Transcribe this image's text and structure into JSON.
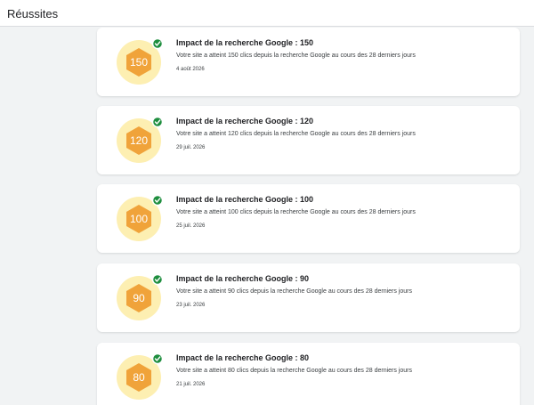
{
  "header": {
    "title": "Réussites"
  },
  "colors": {
    "badge_ring": "#fdefb2",
    "badge_hex": "#f0a33a",
    "check": "#1e8e3e"
  },
  "achievements": [
    {
      "value": "150",
      "title": "Impact de la recherche Google : 150",
      "description": "Votre site a atteint 150 clics depuis la recherche Google au cours des 28 derniers jours",
      "date": "4 août 2026"
    },
    {
      "value": "120",
      "title": "Impact de la recherche Google : 120",
      "description": "Votre site a atteint 120 clics depuis la recherche Google au cours des 28 derniers jours",
      "date": "29 juil. 2026"
    },
    {
      "value": "100",
      "title": "Impact de la recherche Google : 100",
      "description": "Votre site a atteint 100 clics depuis la recherche Google au cours des 28 derniers jours",
      "date": "25 juil. 2026"
    },
    {
      "value": "90",
      "title": "Impact de la recherche Google : 90",
      "description": "Votre site a atteint 90 clics depuis la recherche Google au cours des 28 derniers jours",
      "date": "23 juil. 2026"
    },
    {
      "value": "80",
      "title": "Impact de la recherche Google : 80",
      "description": "Votre site a atteint 80 clics depuis la recherche Google au cours des 28 derniers jours",
      "date": "21 juil. 2026"
    }
  ]
}
